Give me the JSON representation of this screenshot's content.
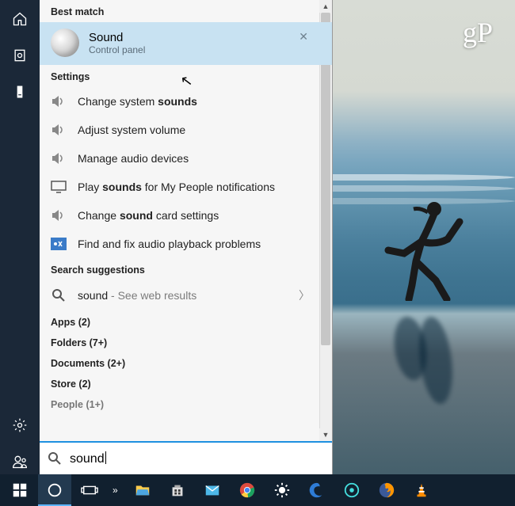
{
  "watermark": "gP",
  "rail": {
    "home": "home",
    "recent": "recent",
    "device": "device",
    "settings": "settings",
    "user": "user"
  },
  "search": {
    "best_match_label": "Best match",
    "best": {
      "title": "Sound",
      "subtitle": "Control panel"
    },
    "settings_label": "Settings",
    "settings": [
      {
        "pre": "Change system ",
        "b": "sounds",
        "post": ""
      },
      {
        "pre": "Adjust system volume",
        "b": "",
        "post": ""
      },
      {
        "pre": "Manage audio devices",
        "b": "",
        "post": ""
      },
      {
        "pre": "Play ",
        "b": "sounds",
        "post": " for My People notifications",
        "icon": "monitor"
      },
      {
        "pre": "Change ",
        "b": "sound",
        "post": " card settings"
      },
      {
        "pre": "Find and fix audio playback problems",
        "b": "",
        "post": "",
        "icon": "trouble"
      }
    ],
    "suggestions_label": "Search suggestions",
    "suggestion": {
      "term": "sound",
      "hint": " - See web results"
    },
    "categories": [
      "Apps (2)",
      "Folders (7+)",
      "Documents (2+)",
      "Store (2)",
      "People (1+)"
    ],
    "input_value": "sound"
  },
  "taskbar": {
    "items": [
      "start",
      "cortana",
      "taskview",
      "overflow",
      "explorer",
      "store",
      "mail",
      "chrome",
      "brightness",
      "edge",
      "oculus",
      "firefox",
      "vlc"
    ]
  }
}
